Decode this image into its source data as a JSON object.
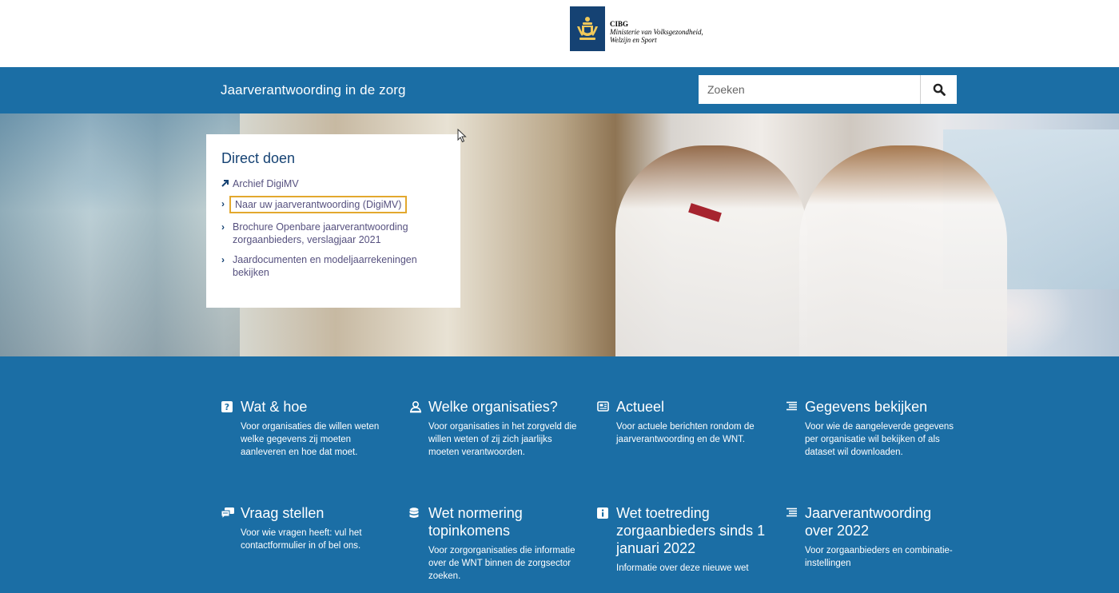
{
  "logo": {
    "org": "CIBG",
    "ministry_line1": "Ministerie van Volksgezondheid,",
    "ministry_line2": "Welzijn en Sport"
  },
  "navbar": {
    "site_title": "Jaarverantwoording in de zorg",
    "search_placeholder": "Zoeken",
    "search_icon": "search-icon"
  },
  "direct": {
    "title": "Direct doen",
    "items": [
      {
        "label": "Archief DigiMV",
        "icon": "external-link-arrow-icon"
      },
      {
        "label": "Naar uw jaarverantwoording (DigiMV)",
        "icon": "chevron-right-icon",
        "highlighted": true
      },
      {
        "label": "Brochure Openbare jaarverantwoording zorgaanbieders, verslagjaar 2021",
        "icon": "chevron-right-icon"
      },
      {
        "label": "Jaardocumenten en modeljaarrekeningen bekijken",
        "icon": "chevron-right-icon"
      }
    ]
  },
  "tiles": [
    {
      "title": "Wat & hoe",
      "desc": "Voor organisaties die willen weten welke gegevens zij moeten aanleveren en hoe dat moet.",
      "icon": "question-icon"
    },
    {
      "title": "Welke organisaties?",
      "desc": "Voor organisaties in het zorgveld die willen weten of zij zich jaarlijks moeten verantwoorden.",
      "icon": "organization-icon"
    },
    {
      "title": "Actueel",
      "desc": "Voor actuele berichten rondom de jaarverantwoording en de WNT.",
      "icon": "news-icon"
    },
    {
      "title": "Gegevens bekijken",
      "desc": "Voor wie de aangeleverde gegevens per organisatie wil bekijken of als dataset wil downloaden.",
      "icon": "list-icon"
    },
    {
      "title": "Vraag stellen",
      "desc": "Voor wie vragen heeft: vul het contactformulier in of bel ons.",
      "icon": "chat-icon"
    },
    {
      "title": "Wet normering topinkomens",
      "desc": "Voor zorgorganisaties die informatie over de WNT binnen de zorgsector zoeken.",
      "icon": "database-icon"
    },
    {
      "title": "Wet toetreding zorgaanbieders sinds 1 januari 2022",
      "desc": "Informatie over deze nieuwe wet",
      "icon": "info-icon"
    },
    {
      "title": "Jaarverantwoording over 2022",
      "desc": "Voor zorgaanbieders en combinatie-instellingen",
      "icon": "list-icon"
    }
  ],
  "colors": {
    "brand_blue": "#1b6ea5",
    "dark_blue": "#154273",
    "highlight": "#e3a82e"
  }
}
